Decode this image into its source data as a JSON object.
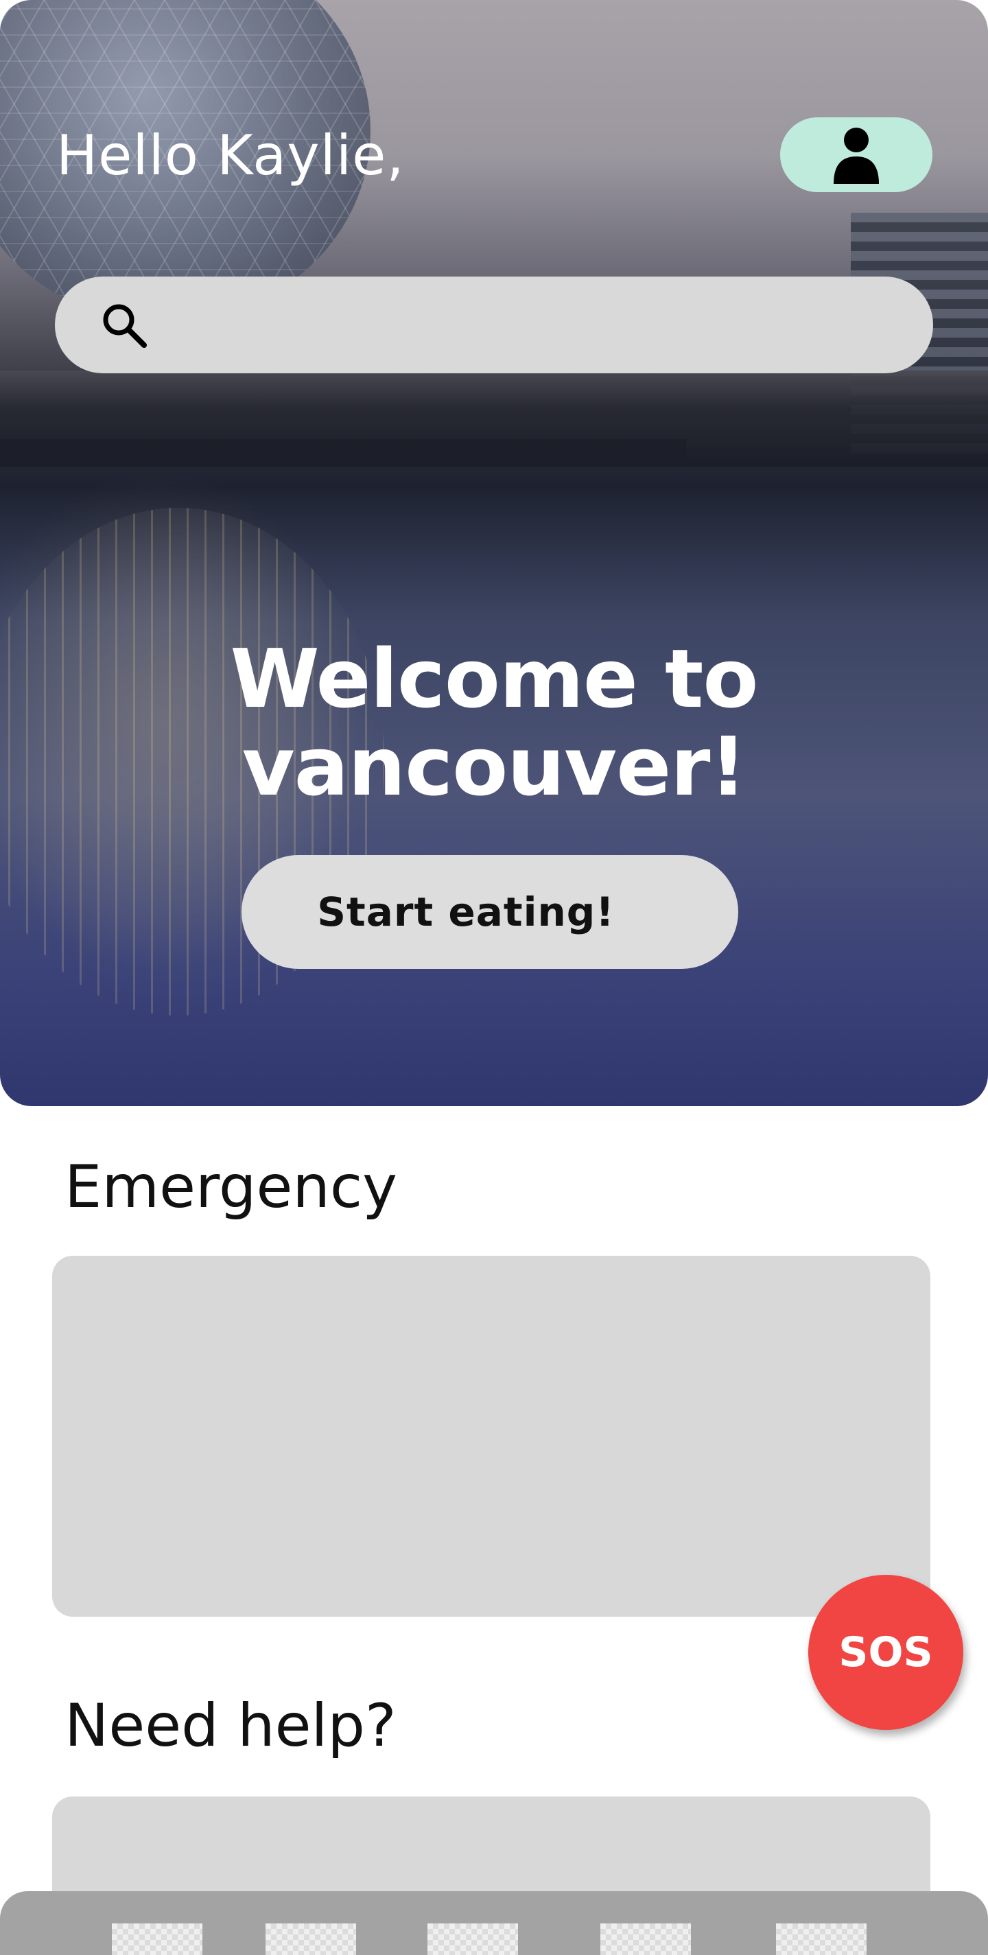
{
  "header": {
    "greeting": "Hello Kaylie,",
    "profile_icon": "user-icon",
    "profile_color": "#bfebdd"
  },
  "search": {
    "icon": "search-icon",
    "value": "",
    "placeholder": ""
  },
  "hero": {
    "welcome_line1": "Welcome to",
    "welcome_line2": "vancouver!",
    "start_label": "Start eating!"
  },
  "sections": {
    "emergency_title": "Emergency",
    "help_title": "Need help?"
  },
  "sos": {
    "label": "SOS",
    "color": "#f04542"
  },
  "bottom_nav": {
    "items": [
      "nav-item-1",
      "nav-item-2",
      "nav-item-3",
      "nav-item-4",
      "nav-item-5"
    ]
  }
}
